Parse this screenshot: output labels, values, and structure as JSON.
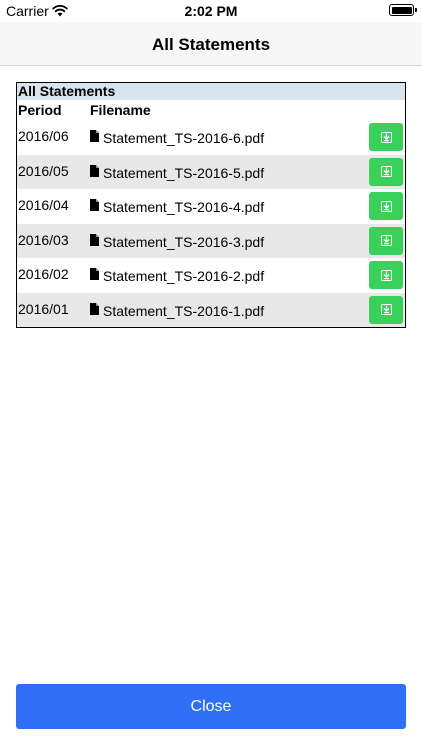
{
  "status_bar": {
    "carrier": "Carrier",
    "time": "2:02 PM"
  },
  "nav": {
    "title": "All Statements"
  },
  "table": {
    "caption": "All Statements",
    "columns": {
      "period": "Period",
      "filename": "Filename"
    },
    "rows": [
      {
        "period": "2016/06",
        "filename": "Statement_TS-2016-6.pdf"
      },
      {
        "period": "2016/05",
        "filename": "Statement_TS-2016-5.pdf"
      },
      {
        "period": "2016/04",
        "filename": "Statement_TS-2016-4.pdf"
      },
      {
        "period": "2016/03",
        "filename": "Statement_TS-2016-3.pdf"
      },
      {
        "period": "2016/02",
        "filename": "Statement_TS-2016-2.pdf"
      },
      {
        "period": "2016/01",
        "filename": "Statement_TS-2016-1.pdf"
      }
    ]
  },
  "footer": {
    "close_label": "Close"
  },
  "colors": {
    "download_green": "#3ad15a",
    "close_blue": "#2f6ff5",
    "caption_bg": "#d7e4ee",
    "shaded_row": "#e8e8e8"
  },
  "icons": {
    "wifi": "wifi-icon",
    "battery": "battery-icon",
    "file": "file-icon",
    "download": "download-icon"
  }
}
